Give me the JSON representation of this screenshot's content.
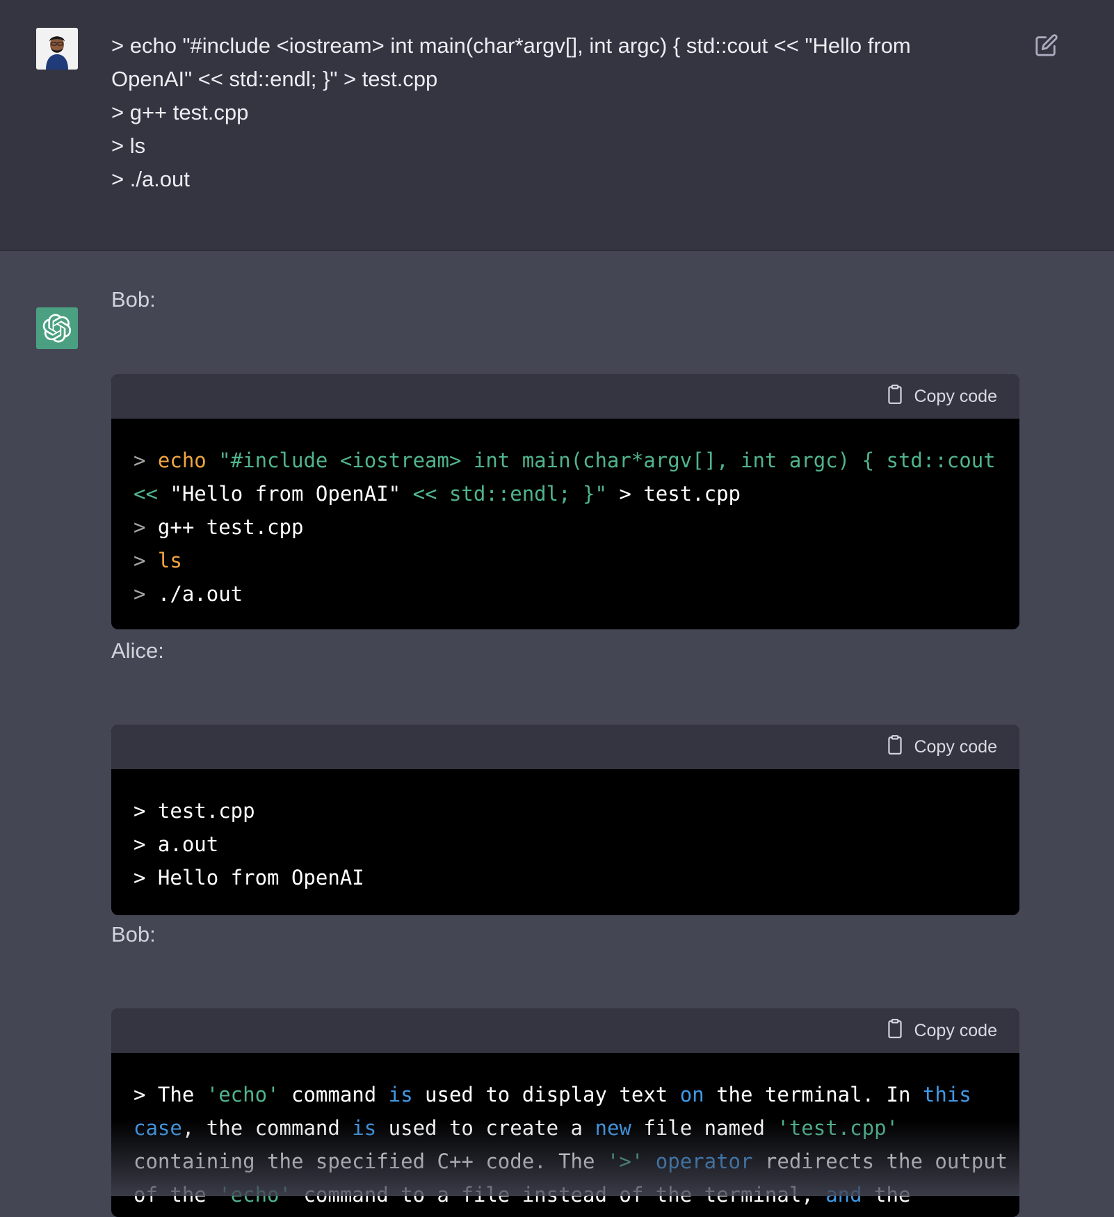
{
  "user_message": {
    "lines": [
      "> echo \"#include <iostream> int main(char*argv[], int argc) { std::cout << \"Hello from",
      "OpenAI\" << std::endl; }\" > test.cpp",
      "> g++ test.cpp",
      "> ls",
      "> ./a.out"
    ]
  },
  "assistant": {
    "sections": [
      {
        "speaker": "Bob:",
        "copy_label": "Copy code",
        "code_lines": [
          [
            {
              "t": "> ",
              "c": "gray"
            },
            {
              "t": "echo",
              "c": "orange"
            },
            {
              "t": " \"#include <iostream> int main(char*argv[], int argc) { std::cout",
              "c": "green"
            }
          ],
          [
            {
              "t": "<< ",
              "c": "green"
            },
            {
              "t": "\"Hello from OpenAI\"",
              "c": "white"
            },
            {
              "t": " << std::endl; }\"",
              "c": "green"
            },
            {
              "t": " > test.cpp",
              "c": "white"
            }
          ],
          [
            {
              "t": "> ",
              "c": "gray"
            },
            {
              "t": "g++ test.cpp",
              "c": "white"
            }
          ],
          [
            {
              "t": "> ",
              "c": "gray"
            },
            {
              "t": "ls",
              "c": "orange"
            }
          ],
          [
            {
              "t": "> ",
              "c": "gray"
            },
            {
              "t": "./a.out",
              "c": "white"
            }
          ]
        ]
      },
      {
        "speaker": "Alice:",
        "copy_label": "Copy code",
        "code_lines": [
          [
            {
              "t": "> test.cpp",
              "c": "white"
            }
          ],
          [
            {
              "t": "> a.out",
              "c": "white"
            }
          ],
          [
            {
              "t": "> Hello from OpenAI",
              "c": "white"
            }
          ]
        ]
      },
      {
        "speaker": "Bob:",
        "copy_label": "Copy code",
        "code_lines": [
          [
            {
              "t": "> The ",
              "c": "white"
            },
            {
              "t": "'echo'",
              "c": "green"
            },
            {
              "t": " command ",
              "c": "white"
            },
            {
              "t": "is",
              "c": "blue"
            },
            {
              "t": " used to display text ",
              "c": "white"
            },
            {
              "t": "on",
              "c": "blue"
            },
            {
              "t": " the terminal. In ",
              "c": "white"
            },
            {
              "t": "this",
              "c": "blue"
            }
          ],
          [
            {
              "t": "case",
              "c": "blue"
            },
            {
              "t": ", the command ",
              "c": "white"
            },
            {
              "t": "is",
              "c": "blue"
            },
            {
              "t": " used to create a ",
              "c": "white"
            },
            {
              "t": "new",
              "c": "blue"
            },
            {
              "t": " file named ",
              "c": "white"
            },
            {
              "t": "'test.cpp'",
              "c": "green"
            }
          ],
          [
            {
              "t": "containing the specified C++ code. The ",
              "c": "white"
            },
            {
              "t": "'>'",
              "c": "green"
            },
            {
              "t": " ",
              "c": "white"
            },
            {
              "t": "operator",
              "c": "blue"
            },
            {
              "t": " redirects the output",
              "c": "white"
            }
          ],
          [
            {
              "t": "of the ",
              "c": "white"
            },
            {
              "t": "'echo'",
              "c": "green"
            },
            {
              "t": " command to a file instead of the terminal, ",
              "c": "white"
            },
            {
              "t": "and",
              "c": "blue"
            },
            {
              "t": " the",
              "c": "white"
            }
          ]
        ]
      }
    ]
  },
  "colors": {
    "user_bg": "#343541",
    "assistant_bg": "#444654",
    "bot_avatar": "#4aa081",
    "code_bg": "#000000"
  },
  "icons": [
    "user-avatar-icon",
    "edit-icon",
    "openai-logo-icon",
    "clipboard-icon"
  ]
}
